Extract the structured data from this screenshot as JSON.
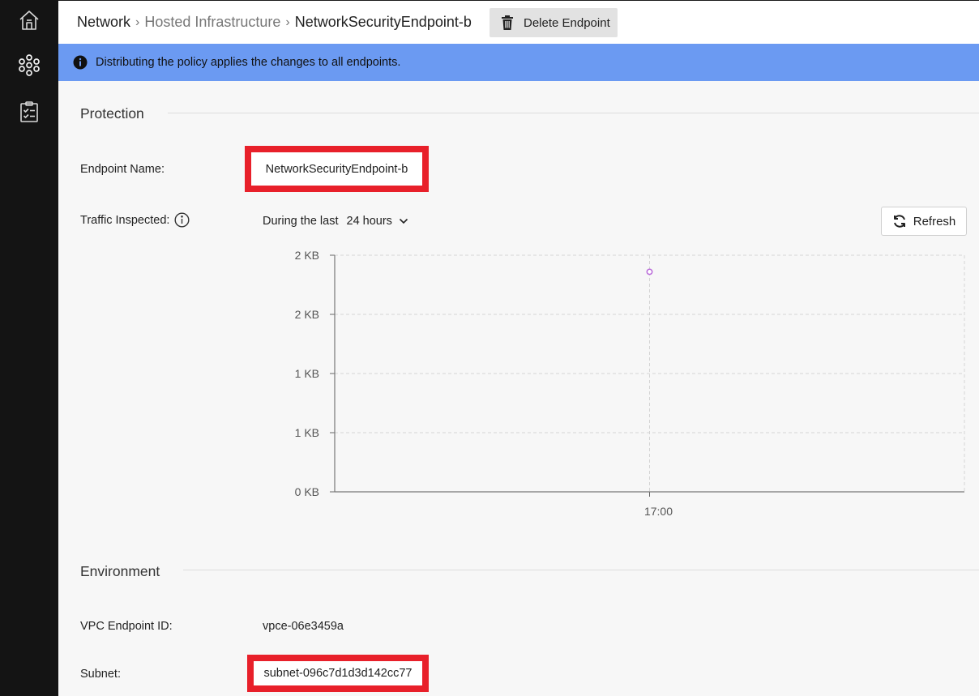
{
  "breadcrumb": {
    "network": "Network",
    "hosted": "Hosted Infrastructure",
    "current": "NetworkSecurityEndpoint-b"
  },
  "toolbar": {
    "delete_label": "Delete Endpoint"
  },
  "banner": {
    "message": "Distributing the policy applies the changes to all endpoints."
  },
  "protection": {
    "title": "Protection",
    "endpoint_name_label": "Endpoint Name:",
    "endpoint_name_value": "NetworkSecurityEndpoint-b",
    "traffic_label": "Traffic Inspected:",
    "range_prefix": "During the last",
    "range_value": "24 hours",
    "refresh_label": "Refresh"
  },
  "chart_data": {
    "type": "scatter",
    "x_ticks": [
      "17:00"
    ],
    "y_ticks": [
      "0 KB",
      "1 KB",
      "1 KB",
      "2 KB",
      "2 KB"
    ],
    "points": [
      {
        "x": "17:00",
        "y_kb": 1.86
      }
    ],
    "ylim": [
      0,
      2
    ],
    "grid": true,
    "point_color": "#b96ad9"
  },
  "environment": {
    "title": "Environment",
    "vpc_label": "VPC Endpoint ID:",
    "vpc_value": "vpce-06e3459a",
    "subnet_label": "Subnet:",
    "subnet_value": "subnet-096c7d1d3d142cc77"
  },
  "colors": {
    "sidebar": "#141414",
    "banner": "#6b9af2",
    "highlight": "#e8202a"
  }
}
